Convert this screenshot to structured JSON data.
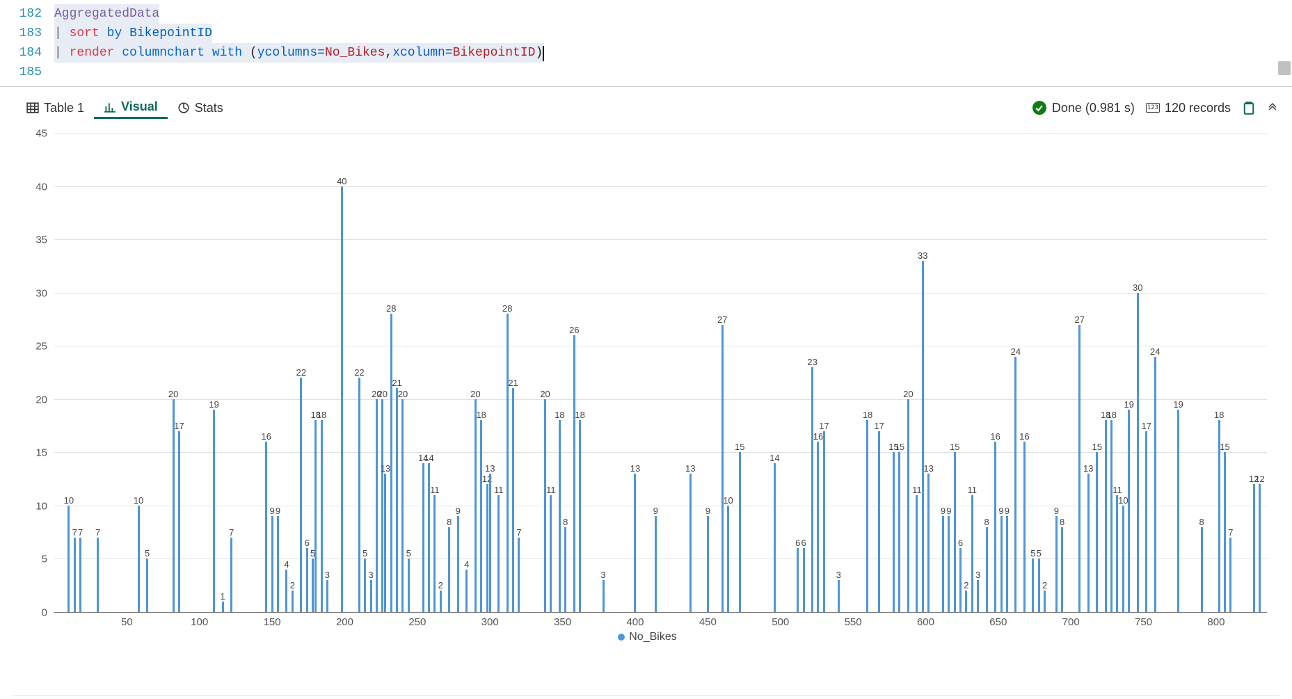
{
  "editor": {
    "lines": [
      {
        "num": "182"
      },
      {
        "num": "183"
      },
      {
        "num": "184"
      },
      {
        "num": "185"
      }
    ],
    "line182": {
      "ident": "AggregatedData"
    },
    "line183": {
      "pipe": "|",
      "kw": "sort",
      "op": "by",
      "prop": "BikepointID"
    },
    "line184": {
      "pipe": "|",
      "kw": "render",
      "op1": "columnchart",
      "op2": "with",
      "p1": "ycolumns=",
      "v1": "No_Bikes",
      "comma": ",",
      "p2": "xcolumn=",
      "v2": "BikepointID"
    }
  },
  "tabs": {
    "table": "Table 1",
    "visual": "Visual",
    "stats": "Stats"
  },
  "status": {
    "done": "Done (0.981 s)",
    "records": "120 records"
  },
  "legend": {
    "series": "No_Bikes"
  },
  "chart_data": {
    "type": "bar",
    "title": "",
    "xlabel": "",
    "ylabel": "",
    "xlim": [
      0,
      835
    ],
    "ylim": [
      0,
      45
    ],
    "yticks": [
      0,
      5,
      10,
      15,
      20,
      25,
      30,
      35,
      40,
      45
    ],
    "xticks": [
      50,
      100,
      150,
      200,
      250,
      300,
      350,
      400,
      450,
      500,
      550,
      600,
      650,
      700,
      750,
      800
    ],
    "series_name": "No_Bikes",
    "points": [
      {
        "x": 10,
        "y": 10
      },
      {
        "x": 14,
        "y": 7
      },
      {
        "x": 18,
        "y": 7
      },
      {
        "x": 30,
        "y": 7
      },
      {
        "x": 58,
        "y": 10
      },
      {
        "x": 64,
        "y": 5
      },
      {
        "x": 82,
        "y": 20
      },
      {
        "x": 86,
        "y": 17
      },
      {
        "x": 110,
        "y": 19
      },
      {
        "x": 116,
        "y": 1
      },
      {
        "x": 122,
        "y": 7
      },
      {
        "x": 146,
        "y": 16
      },
      {
        "x": 150,
        "y": 9
      },
      {
        "x": 154,
        "y": 9
      },
      {
        "x": 160,
        "y": 4
      },
      {
        "x": 164,
        "y": 2
      },
      {
        "x": 170,
        "y": 22
      },
      {
        "x": 174,
        "y": 6
      },
      {
        "x": 178,
        "y": 5
      },
      {
        "x": 180,
        "y": 18
      },
      {
        "x": 184,
        "y": 18
      },
      {
        "x": 188,
        "y": 3
      },
      {
        "x": 198,
        "y": 40
      },
      {
        "x": 210,
        "y": 22
      },
      {
        "x": 214,
        "y": 5
      },
      {
        "x": 218,
        "y": 3
      },
      {
        "x": 222,
        "y": 20
      },
      {
        "x": 226,
        "y": 20
      },
      {
        "x": 228,
        "y": 13
      },
      {
        "x": 232,
        "y": 28
      },
      {
        "x": 236,
        "y": 21
      },
      {
        "x": 240,
        "y": 20
      },
      {
        "x": 244,
        "y": 5
      },
      {
        "x": 254,
        "y": 14
      },
      {
        "x": 258,
        "y": 14
      },
      {
        "x": 262,
        "y": 11
      },
      {
        "x": 266,
        "y": 2
      },
      {
        "x": 272,
        "y": 8
      },
      {
        "x": 278,
        "y": 9
      },
      {
        "x": 284,
        "y": 4
      },
      {
        "x": 290,
        "y": 20
      },
      {
        "x": 294,
        "y": 18
      },
      {
        "x": 298,
        "y": 12
      },
      {
        "x": 300,
        "y": 13
      },
      {
        "x": 306,
        "y": 11
      },
      {
        "x": 312,
        "y": 28
      },
      {
        "x": 316,
        "y": 21
      },
      {
        "x": 320,
        "y": 7
      },
      {
        "x": 338,
        "y": 20
      },
      {
        "x": 342,
        "y": 11
      },
      {
        "x": 348,
        "y": 18
      },
      {
        "x": 352,
        "y": 8
      },
      {
        "x": 358,
        "y": 26
      },
      {
        "x": 362,
        "y": 18
      },
      {
        "x": 378,
        "y": 3
      },
      {
        "x": 400,
        "y": 13
      },
      {
        "x": 414,
        "y": 9
      },
      {
        "x": 438,
        "y": 13
      },
      {
        "x": 450,
        "y": 9
      },
      {
        "x": 460,
        "y": 27
      },
      {
        "x": 464,
        "y": 10
      },
      {
        "x": 472,
        "y": 15
      },
      {
        "x": 496,
        "y": 14
      },
      {
        "x": 512,
        "y": 6
      },
      {
        "x": 516,
        "y": 6
      },
      {
        "x": 522,
        "y": 23
      },
      {
        "x": 526,
        "y": 16
      },
      {
        "x": 530,
        "y": 17
      },
      {
        "x": 540,
        "y": 3
      },
      {
        "x": 560,
        "y": 18
      },
      {
        "x": 568,
        "y": 17
      },
      {
        "x": 578,
        "y": 15
      },
      {
        "x": 582,
        "y": 15
      },
      {
        "x": 588,
        "y": 20
      },
      {
        "x": 594,
        "y": 11
      },
      {
        "x": 598,
        "y": 33
      },
      {
        "x": 602,
        "y": 13
      },
      {
        "x": 612,
        "y": 9
      },
      {
        "x": 616,
        "y": 9
      },
      {
        "x": 620,
        "y": 15
      },
      {
        "x": 624,
        "y": 6
      },
      {
        "x": 628,
        "y": 2
      },
      {
        "x": 632,
        "y": 11
      },
      {
        "x": 636,
        "y": 3
      },
      {
        "x": 642,
        "y": 8
      },
      {
        "x": 648,
        "y": 16
      },
      {
        "x": 652,
        "y": 9
      },
      {
        "x": 656,
        "y": 9
      },
      {
        "x": 662,
        "y": 24
      },
      {
        "x": 668,
        "y": 16
      },
      {
        "x": 674,
        "y": 5
      },
      {
        "x": 678,
        "y": 5
      },
      {
        "x": 682,
        "y": 2
      },
      {
        "x": 690,
        "y": 9
      },
      {
        "x": 694,
        "y": 8
      },
      {
        "x": 706,
        "y": 27
      },
      {
        "x": 712,
        "y": 13
      },
      {
        "x": 718,
        "y": 15
      },
      {
        "x": 724,
        "y": 18
      },
      {
        "x": 728,
        "y": 18
      },
      {
        "x": 732,
        "y": 11
      },
      {
        "x": 736,
        "y": 10
      },
      {
        "x": 740,
        "y": 19
      },
      {
        "x": 746,
        "y": 30
      },
      {
        "x": 752,
        "y": 17
      },
      {
        "x": 758,
        "y": 24
      },
      {
        "x": 774,
        "y": 19
      },
      {
        "x": 790,
        "y": 8
      },
      {
        "x": 802,
        "y": 18
      },
      {
        "x": 806,
        "y": 15
      },
      {
        "x": 810,
        "y": 7
      },
      {
        "x": 826,
        "y": 12
      },
      {
        "x": 830,
        "y": 12
      }
    ]
  }
}
